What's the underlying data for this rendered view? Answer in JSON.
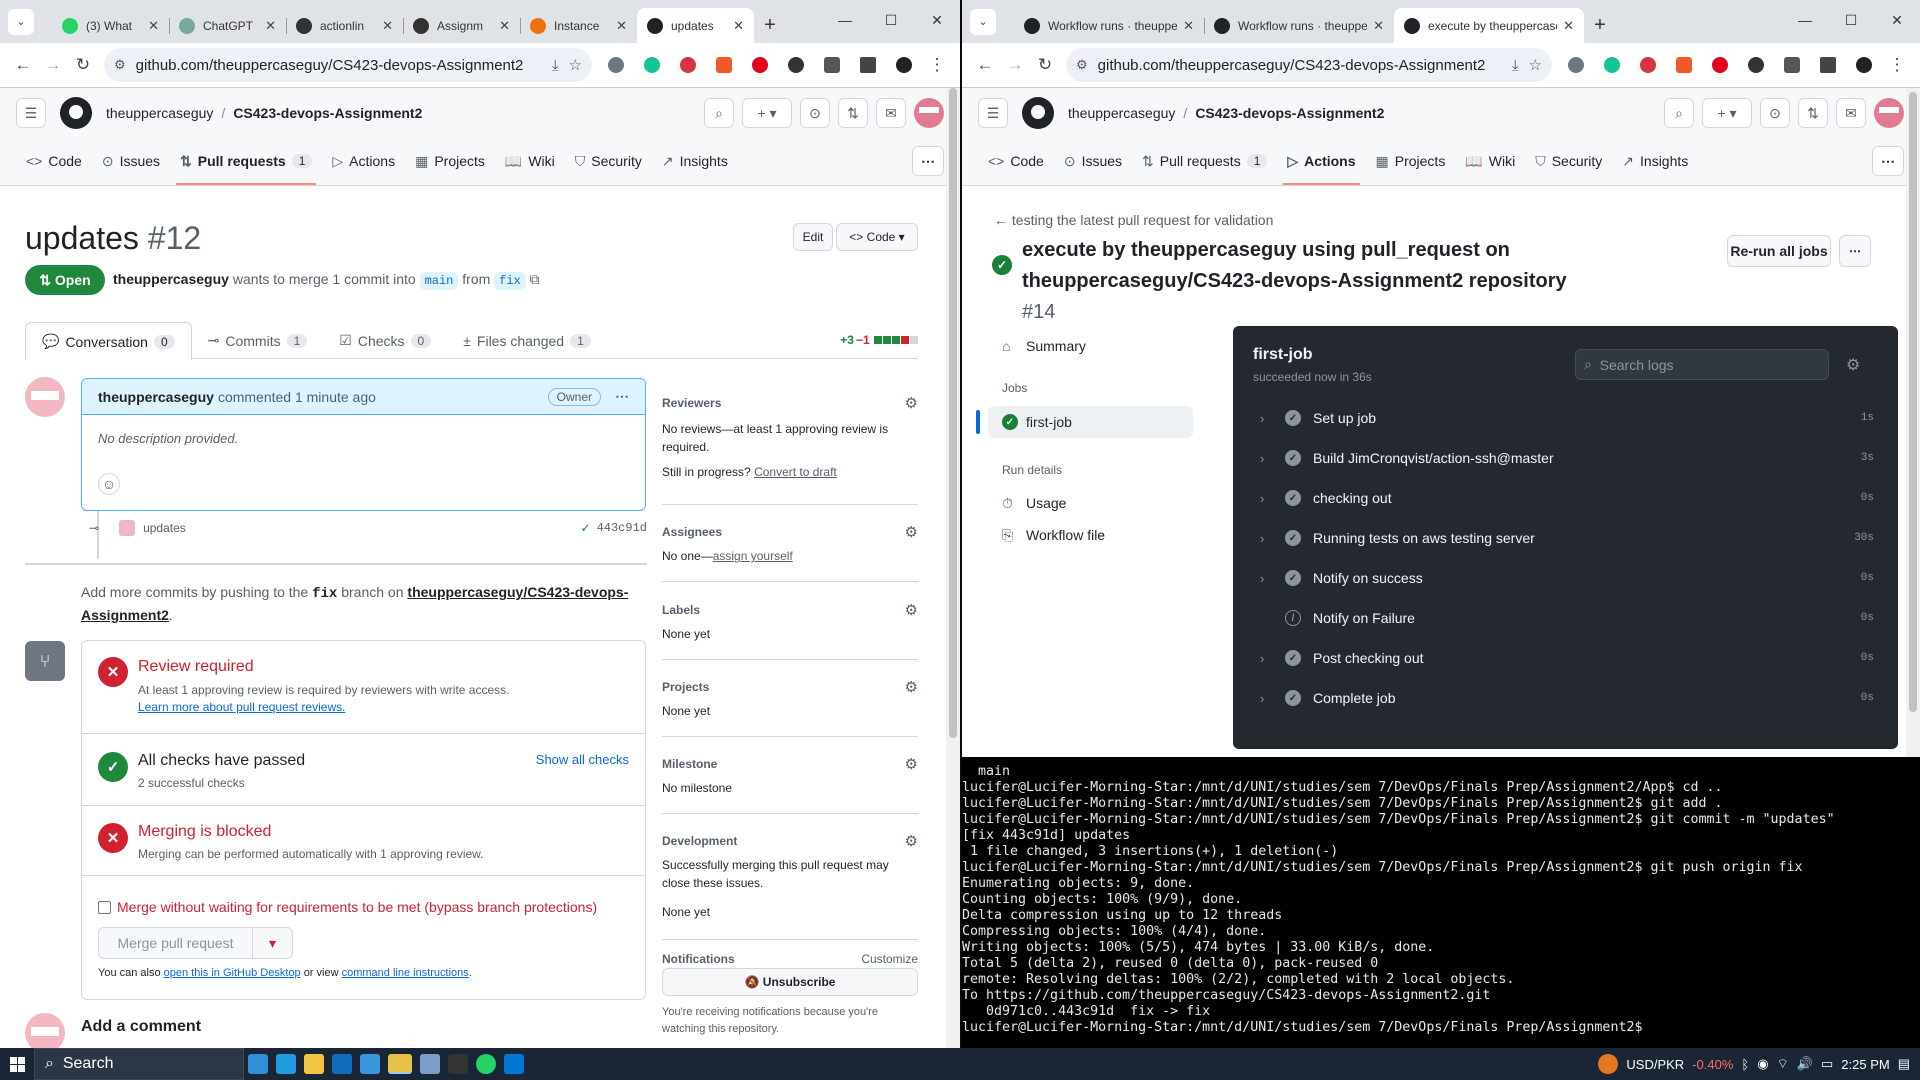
{
  "left": {
    "tabs": [
      {
        "label": "(3) What",
        "color": "#25d366",
        "active": false
      },
      {
        "label": "ChatGPT",
        "color": "#74aa9c",
        "active": false
      },
      {
        "label": "actionlin",
        "color": "#333333",
        "active": false
      },
      {
        "label": "Assignm",
        "color": "#333333",
        "active": false
      },
      {
        "label": "Instance",
        "color": "#ec7211",
        "active": false
      },
      {
        "label": "updates",
        "color": "#1f2328",
        "active": true
      }
    ],
    "url": "github.com/theuppercaseguy/CS423-devops-Assignment2",
    "header": {
      "owner": "theuppercaseguy",
      "repo": "CS423-devops-Assignment2"
    },
    "nav": [
      {
        "label": "Code",
        "icon": "<>",
        "count": ""
      },
      {
        "label": "Issues",
        "icon": "⊙",
        "count": ""
      },
      {
        "label": "Pull requests",
        "icon": "⇅",
        "count": "1"
      },
      {
        "label": "Actions",
        "icon": "▷",
        "count": ""
      },
      {
        "label": "Projects",
        "icon": "▦",
        "count": ""
      },
      {
        "label": "Wiki",
        "icon": "📖",
        "count": ""
      },
      {
        "label": "Security",
        "icon": "⛉",
        "count": ""
      },
      {
        "label": "Insights",
        "icon": "↗",
        "count": ""
      }
    ],
    "pr": {
      "title": "updates",
      "number": "#12",
      "edit_label": "Edit",
      "code_label": "Code",
      "state": "Open",
      "author": "theuppercaseguy",
      "meta_mid": "wants to merge 1 commit into",
      "base": "main",
      "from_word": "from",
      "head": "fix",
      "tabs": [
        {
          "label": "Conversation",
          "count": "0"
        },
        {
          "label": "Commits",
          "count": "1"
        },
        {
          "label": "Checks",
          "count": "0"
        },
        {
          "label": "Files changed",
          "count": "1"
        }
      ],
      "additions": "+3",
      "deletions": "−1",
      "comment": {
        "author": "theuppercaseguy",
        "action": "commented 1 minute ago",
        "role": "Owner",
        "body": "No description provided."
      },
      "commit": {
        "message": "updates",
        "sha": "443c91d"
      },
      "push_hint_pre": "Add more commits by pushing to the",
      "push_hint_branch": "fix",
      "push_hint_mid": "branch on",
      "push_hint_repo": "theuppercaseguy/CS423-devops-Assignment2",
      "checks": [
        {
          "title": "Review required",
          "sub": "At least 1 approving review is required by reviewers with write access.",
          "link": "Learn more about pull request reviews.",
          "status": "fail"
        },
        {
          "title": "All checks have passed",
          "sub": "2 successful checks",
          "link": "Show all checks",
          "status": "pass"
        },
        {
          "title": "Merging is blocked",
          "sub": "Merging can be performed automatically with 1 approving review.",
          "link": "",
          "status": "fail"
        }
      ],
      "bypass_label": "Merge without waiting for requirements to be met (bypass branch protections)",
      "merge_button": "Merge pull request",
      "also_pre": "You can also",
      "also_link1": "open this in GitHub Desktop",
      "also_mid": "or view",
      "also_link2": "command line instructions",
      "add_comment": "Add a comment"
    },
    "sidebar": {
      "reviewers_h": "Reviewers",
      "reviewers_t": "No reviews—at least 1 approving review is required.",
      "progress_pre": "Still in progress?",
      "progress_link": "Convert to draft",
      "assignees_h": "Assignees",
      "assignees_t": "No one—",
      "assignees_link": "assign yourself",
      "labels_h": "Labels",
      "labels_t": "None yet",
      "projects_h": "Projects",
      "projects_t": "None yet",
      "milestone_h": "Milestone",
      "milestone_t": "No milestone",
      "development_h": "Development",
      "development_t": "Successfully merging this pull request may close these issues.",
      "development_t2": "None yet",
      "notifications_h": "Notifications",
      "customize": "Customize",
      "unsubscribe": "Unsubscribe",
      "notif_t": "You're receiving notifications because you're watching this repository."
    }
  },
  "right": {
    "tabs": [
      {
        "label": "Workflow runs · theuppercase",
        "color": "#1f2328",
        "active": false
      },
      {
        "label": "Workflow runs · theuppercase",
        "color": "#1f2328",
        "active": false
      },
      {
        "label": "execute by theuppercaseguy u",
        "color": "#1f2328",
        "active": true
      }
    ],
    "url": "github.com/theuppercaseguy/CS423-devops-Assignment2",
    "back_label": "testing the latest pull request for validation",
    "run_title": "execute by theuppercaseguy using pull_request on theuppercaseguy/CS423-devops-Assignment2 repository",
    "run_number": "#14",
    "rerun_label": "Re-run all jobs",
    "side": {
      "summary": "Summary",
      "jobs_h": "Jobs",
      "job": "first-job",
      "details_h": "Run details",
      "usage": "Usage",
      "workflow_file": "Workflow file"
    },
    "job": {
      "name": "first-job",
      "status": "succeeded now in 36s",
      "search_placeholder": "Search logs"
    },
    "steps": [
      {
        "name": "Set up job",
        "duration": "1s",
        "skipped": false
      },
      {
        "name": "Build JimCronqvist/action-ssh@master",
        "duration": "3s",
        "skipped": false
      },
      {
        "name": "checking out",
        "duration": "0s",
        "skipped": false
      },
      {
        "name": "Running tests on aws testing server",
        "duration": "30s",
        "skipped": false
      },
      {
        "name": "Notify on success",
        "duration": "0s",
        "skipped": false
      },
      {
        "name": "Notify on Failure",
        "duration": "0s",
        "skipped": true
      },
      {
        "name": "Post checking out",
        "duration": "0s",
        "skipped": false
      },
      {
        "name": "Complete job",
        "duration": "0s",
        "skipped": false
      }
    ]
  },
  "terminal": {
    "lines": [
      "  main",
      "lucifer@Lucifer-Morning-Star:/mnt/d/UNI/studies/sem 7/DevOps/Finals Prep/Assignment2/App$ cd ..",
      "lucifer@Lucifer-Morning-Star:/mnt/d/UNI/studies/sem 7/DevOps/Finals Prep/Assignment2$ git add .",
      "lucifer@Lucifer-Morning-Star:/mnt/d/UNI/studies/sem 7/DevOps/Finals Prep/Assignment2$ git commit -m \"updates\"",
      "[fix 443c91d] updates",
      " 1 file changed, 3 insertions(+), 1 deletion(-)",
      "lucifer@Lucifer-Morning-Star:/mnt/d/UNI/studies/sem 7/DevOps/Finals Prep/Assignment2$ git push origin fix",
      "Enumerating objects: 9, done.",
      "Counting objects: 100% (9/9), done.",
      "Delta compression using up to 12 threads",
      "Compressing objects: 100% (4/4), done.",
      "Writing objects: 100% (5/5), 474 bytes | 33.00 KiB/s, done.",
      "Total 5 (delta 2), reused 0 (delta 0), pack-reused 0",
      "remote: Resolving deltas: 100% (2/2), completed with 2 local objects.",
      "To https://github.com/theuppercaseguy/CS423-devops-Assignment2.git",
      "   0d971c0..443c91d  fix -> fix",
      "lucifer@Lucifer-Morning-Star:/mnt/d/UNI/studies/sem 7/DevOps/Finals Prep/Assignment2$ "
    ]
  },
  "taskbar": {
    "search": "Search",
    "ticker": "USD/PKR",
    "change": "-0.40%",
    "time": "2:25 PM"
  }
}
